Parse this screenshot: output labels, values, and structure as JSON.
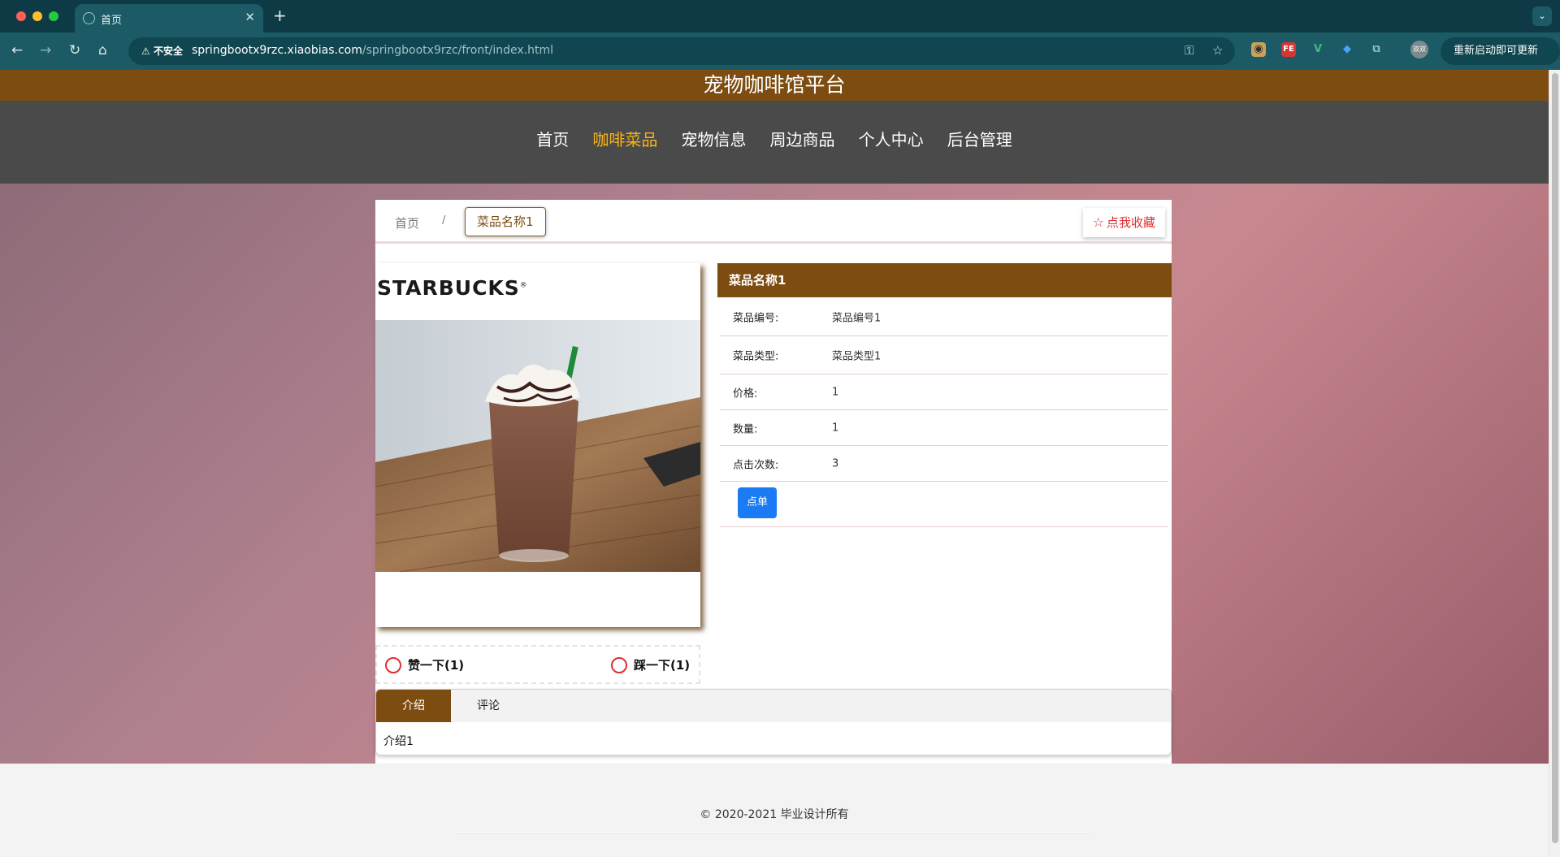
{
  "browser": {
    "tab_title": "首页",
    "insecure_label": "不安全",
    "url_host": "springbootx9rzc.xiaobias.com",
    "url_path": "/springbootx9rzc/front/index.html",
    "restart_label": "重新启动即可更新",
    "profile_label": "双双"
  },
  "site": {
    "title": "宠物咖啡馆平台",
    "nav": [
      {
        "label": "首页"
      },
      {
        "label": "咖啡菜品"
      },
      {
        "label": "宠物信息"
      },
      {
        "label": "周边商品"
      },
      {
        "label": "个人中心"
      },
      {
        "label": "后台管理"
      }
    ]
  },
  "breadcrumb": {
    "home": "首页",
    "separator": "/",
    "current": "菜品名称1"
  },
  "favorite_label": "点我收藏",
  "product": {
    "brand_text": "STARBUCKS",
    "trademark": "®",
    "name": "菜品名称1",
    "rows": [
      {
        "key": "菜品编号:",
        "value": "菜品编号1"
      },
      {
        "key": "菜品类型:",
        "value": "菜品类型1"
      },
      {
        "key": "价格:",
        "value": "1"
      },
      {
        "key": "数量:",
        "value": "1"
      },
      {
        "key": "点击次数:",
        "value": "3"
      }
    ],
    "order_label": "点单",
    "like_label": "赞一下(1)",
    "dislike_label": "踩一下(1)"
  },
  "detail_tabs": {
    "tabs": [
      {
        "label": "介绍"
      },
      {
        "label": "评论"
      }
    ],
    "body": "介绍1"
  },
  "footer": {
    "copyright": "© 2020-2021 毕业设计所有"
  }
}
